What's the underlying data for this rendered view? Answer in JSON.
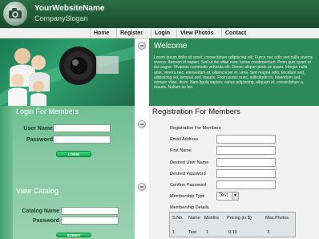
{
  "header": {
    "site_name": "YourWebsiteName",
    "slogan": "CompanySlogan",
    "logo_icon": "camera-icon"
  },
  "nav": {
    "items": [
      {
        "label": "Home"
      },
      {
        "label": "Register"
      },
      {
        "label": "Login"
      },
      {
        "label": "View Photos"
      },
      {
        "label": "Contact"
      }
    ]
  },
  "welcome": {
    "title": "Welcome",
    "body": "Lorem ipsum dolor sit amet, consectetuer adipiscing elit. Fusce nec odio sed nulla viverra viverra. Aenean id sapien. Sed ut dui vitae nunc luctus condimentum. Proin quis quam at dui augue. Vivamus commodo vehicula elit. Donec aliquet pede ac quam. Integer nulla ante, viverra nec, elementum et, ullamcorper in, urna. Sed magna odio, tincidunt sed, adipiscing vel, tempus sed, mauris. Proin purus nunc, sollicitudin in, bibendum sed, semper vitae, diam. Nam ligula sapien, varius adipiscing, aliquam et, consectetuer a, mauris. Nullam ac leo."
  },
  "login": {
    "title": "Login For Members",
    "username_label": "User Name",
    "password_label": "Password",
    "button": "LOGIN"
  },
  "catalog": {
    "title": "View Catalog",
    "catalog_name_label": "Catalog Name",
    "password_label": "Password",
    "button": "SUBMIT"
  },
  "registration": {
    "title": "Registration For Members",
    "subtitle": "Registration For Members",
    "fields": [
      {
        "label": "Email Address"
      },
      {
        "label": "First Name"
      },
      {
        "label": "Desired User Name"
      },
      {
        "label": "Desired Password"
      },
      {
        "label": "Confirm Password"
      }
    ],
    "membership_type_label": "Membership Type",
    "membership_type_value": "Test",
    "membership_details_label": "Membership Details",
    "table": {
      "headers": [
        "S.No.",
        "Name",
        "Months",
        "Pricing (in $)",
        "Max.Photos"
      ],
      "rows": [
        [
          "1",
          "Test",
          "1",
          "0.10",
          "3"
        ]
      ]
    }
  },
  "colors": {
    "header_green": "#1f5a37",
    "welcome_green": "#2e8a58",
    "panel_green": "#86c9a3"
  }
}
